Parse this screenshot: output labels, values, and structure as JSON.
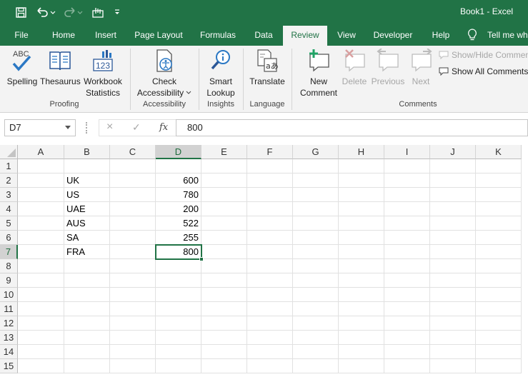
{
  "titlebar": {
    "title": "Book1  -  Excel",
    "quick_access": [
      "save-icon",
      "undo-icon",
      "redo-icon",
      "touch-mode-icon",
      "customize-icon"
    ],
    "color": "#217346"
  },
  "tabs": [
    "File",
    "Home",
    "Insert",
    "Page Layout",
    "Formulas",
    "Data",
    "Review",
    "View",
    "Developer",
    "Help"
  ],
  "active_tab": "Review",
  "tell_me": "Tell me wh",
  "ribbon": {
    "proofing": {
      "label": "Proofing",
      "spelling": "Spelling",
      "thesaurus": "Thesaurus",
      "workbook_statistics_1": "Workbook",
      "workbook_statistics_2": "Statistics"
    },
    "accessibility": {
      "label": "Accessibility",
      "check_1": "Check",
      "check_2": "Accessibility"
    },
    "insights": {
      "label": "Insights",
      "smart_1": "Smart",
      "smart_2": "Lookup"
    },
    "language": {
      "label": "Language",
      "translate": "Translate"
    },
    "comments": {
      "label": "Comments",
      "new_1": "New",
      "new_2": "Comment",
      "delete": "Delete",
      "previous": "Previous",
      "next": "Next",
      "show_hide": "Show/Hide Commen",
      "show_all": "Show All Comments"
    }
  },
  "formula_bar": {
    "name_box": "D7",
    "cancel_icon": "×",
    "enter_icon": "✓",
    "fx_label": "fx",
    "value": "800"
  },
  "grid": {
    "columns": [
      "A",
      "B",
      "C",
      "D",
      "E",
      "F",
      "G",
      "H",
      "I",
      "J",
      "K"
    ],
    "rows": [
      "1",
      "2",
      "3",
      "4",
      "5",
      "6",
      "7",
      "8",
      "9",
      "10",
      "11",
      "12",
      "13",
      "14",
      "15"
    ],
    "selected_cell": "D7",
    "data": [
      {
        "row": 2,
        "b": "UK",
        "d": "600"
      },
      {
        "row": 3,
        "b": "US",
        "d": "780"
      },
      {
        "row": 4,
        "b": "UAE",
        "d": "200"
      },
      {
        "row": 5,
        "b": "AUS",
        "d": "522"
      },
      {
        "row": 6,
        "b": "SA",
        "d": "255"
      },
      {
        "row": 7,
        "b": "FRA",
        "d": "800"
      }
    ]
  }
}
